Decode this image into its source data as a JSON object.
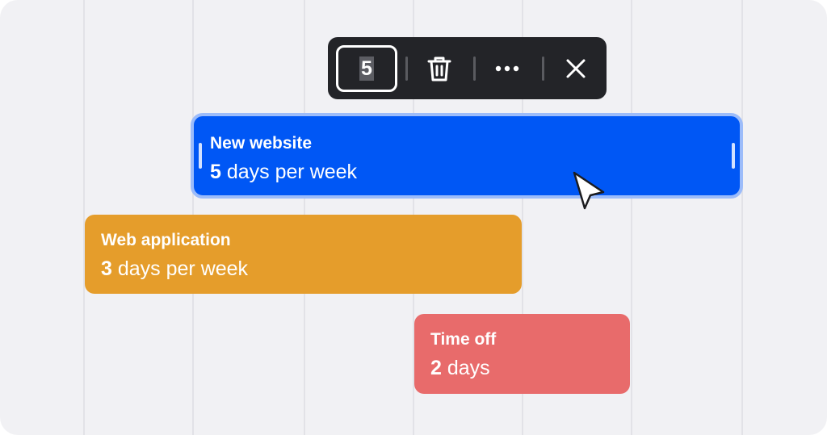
{
  "toolbar": {
    "value": "5",
    "delete_icon": "trash-icon",
    "more_icon": "more-horizontal-icon",
    "close_icon": "close-icon"
  },
  "bars": [
    {
      "title": "New website",
      "count": "5",
      "unit": "days per week",
      "color": "#0057f5",
      "selected": true
    },
    {
      "title": "Web application",
      "count": "3",
      "unit": "days per week",
      "color": "#e59d2b",
      "selected": false
    },
    {
      "title": "Time off",
      "count": "2",
      "unit": "days",
      "color": "#e86b6b",
      "selected": false
    }
  ],
  "colors": {
    "background": "#f1f1f4",
    "grid_line": "#e2e2e7",
    "toolbar": "#232428",
    "selection_outline": "#9cbcfa"
  }
}
